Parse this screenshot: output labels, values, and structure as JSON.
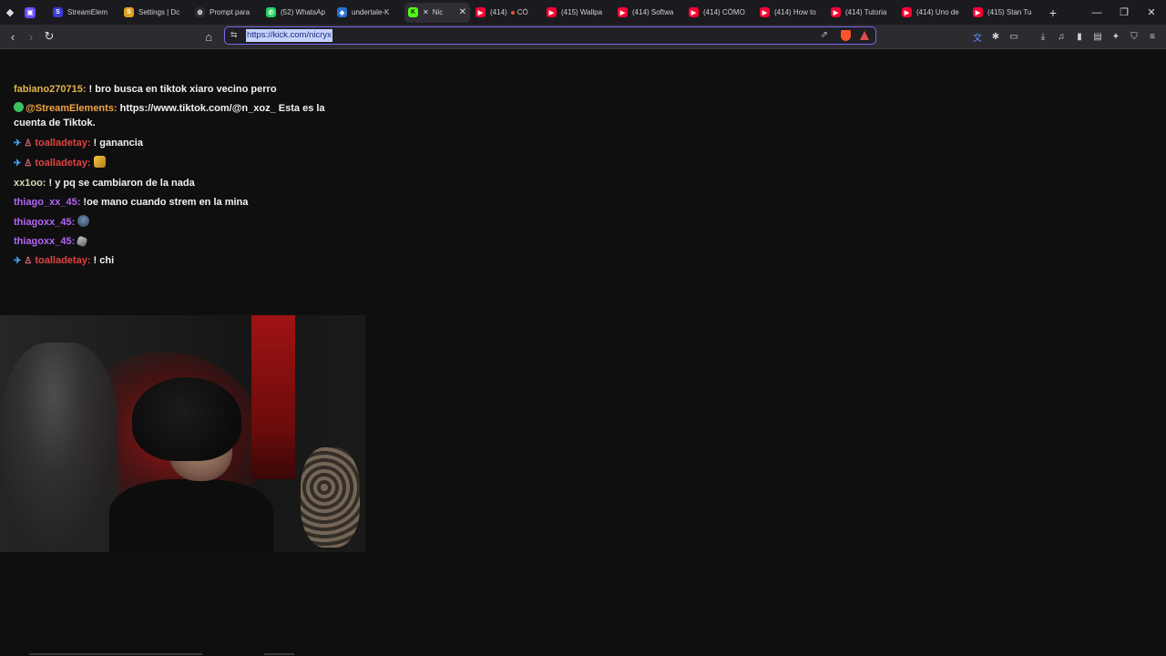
{
  "browser": {
    "tabs": [
      {
        "title": "StreamElem",
        "favicon": "streamelements-icon",
        "color": "#3b3bd8",
        "glyph": "S"
      },
      {
        "title": "Settings | Dc",
        "favicon": "settings-icon",
        "color": "#e0a020",
        "glyph": "S"
      },
      {
        "title": "Prompt para",
        "favicon": "openai-icon",
        "color": "#2b2b30",
        "glyph": "⚙"
      },
      {
        "title": "(52) WhatsAp",
        "favicon": "whatsapp-icon",
        "color": "#25d366",
        "glyph": "✆"
      },
      {
        "title": "undertale-K",
        "favicon": "undertale-icon",
        "color": "#2a6fd6",
        "glyph": "◆"
      },
      {
        "title": "Nic",
        "favicon": "kick-icon",
        "color": "#53fc18",
        "glyph": "K",
        "active": true,
        "muted": true
      },
      {
        "title": "(414)",
        "favicon": "youtube-icon",
        "color": "#ff0033",
        "glyph": "▶",
        "recording": true,
        "extra": "CÓ"
      },
      {
        "title": "(415) Wallpa",
        "favicon": "youtube-icon",
        "color": "#ff0033",
        "glyph": "▶"
      },
      {
        "title": "(414) Softwa",
        "favicon": "youtube-icon",
        "color": "#ff0033",
        "glyph": "▶"
      },
      {
        "title": "(414) CÓMO",
        "favicon": "youtube-icon",
        "color": "#ff0033",
        "glyph": "▶"
      },
      {
        "title": "(414) How to",
        "favicon": "youtube-icon",
        "color": "#ff0033",
        "glyph": "▶"
      },
      {
        "title": "(414) Tutoria",
        "favicon": "youtube-icon",
        "color": "#ff0033",
        "glyph": "▶"
      },
      {
        "title": "(414) Uno de",
        "favicon": "youtube-icon",
        "color": "#ff0033",
        "glyph": "▶"
      },
      {
        "title": "(415) Stan Tu",
        "favicon": "youtube-icon",
        "color": "#ff0033",
        "glyph": "▶"
      }
    ],
    "url": "https://kick.com/nicryx",
    "window_controls": {
      "minimize": "—",
      "maximize": "❐",
      "close": "✕"
    }
  },
  "chat": {
    "messages": [
      {
        "user": "fabiano270715:",
        "text": " ! bro busca en tiktok xiaro vecino perro"
      },
      {
        "user": "@StreamElements:",
        "text": " https://www.tiktok.com/@n_xoz_ Esta es la cuenta de Tiktok."
      },
      {
        "user": "toalladetay:",
        "text": " ! ganancia"
      },
      {
        "user": "toalladetay:",
        "text": ""
      },
      {
        "user": "xx1oo:",
        "text": " ! y pq se cambiaron de la nada"
      },
      {
        "user": "thiago_xx_45:",
        "text": " !oe mano cuando strem en la mina"
      },
      {
        "user": "thiagoxx_45:",
        "text": ""
      },
      {
        "user": "thiagoxx_45:",
        "text": ""
      },
      {
        "user": "toalladetay:",
        "text": " ! chi"
      }
    ]
  },
  "colors": {
    "background": "#0f0f10",
    "accent_url_border": "#7b68ee",
    "kick_green": "#53fc18"
  }
}
